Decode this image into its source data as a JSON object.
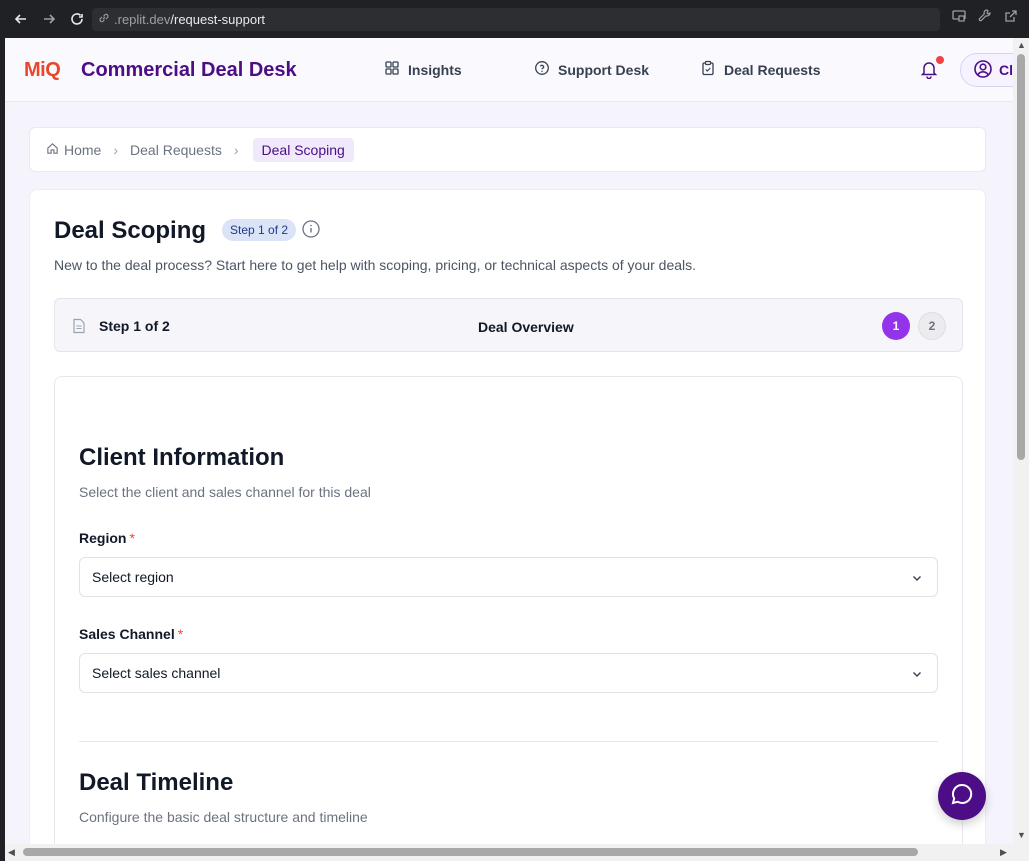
{
  "browser": {
    "url_prefix": ".replit.dev",
    "url_path": "/request-support"
  },
  "header": {
    "logo_m": "Mi",
    "logo_q": "Q",
    "title": "Commercial Deal Desk",
    "nav": [
      {
        "label": "Insights",
        "icon": "grid-icon"
      },
      {
        "label": "Support Desk",
        "icon": "help-circle-icon"
      },
      {
        "label": "Deal Requests",
        "icon": "clipboard-icon"
      }
    ],
    "user_initials": "Cl"
  },
  "breadcrumb": {
    "home": "Home",
    "parent": "Deal Requests",
    "current": "Deal Scoping"
  },
  "page": {
    "title": "Deal Scoping",
    "step_badge": "Step 1 of 2",
    "subtitle": "New to the deal process? Start here to get help with scoping, pricing, or technical aspects of your deals."
  },
  "stepper": {
    "label": "Step 1 of 2",
    "current_name": "Deal Overview",
    "steps": [
      "1",
      "2"
    ],
    "current_step": 1
  },
  "client_info": {
    "title": "Client Information",
    "description": "Select the client and sales channel for this deal",
    "region_label": "Region",
    "region_placeholder": "Select region",
    "channel_label": "Sales Channel",
    "channel_placeholder": "Select sales channel",
    "required_mark": "*"
  },
  "deal_timeline": {
    "title": "Deal Timeline",
    "description": "Configure the basic deal structure and timeline"
  },
  "colors": {
    "brand_purple": "#4c0d86",
    "accent_purple": "#9333ea",
    "logo_red": "#e8472b",
    "required_red": "#ef4444"
  }
}
